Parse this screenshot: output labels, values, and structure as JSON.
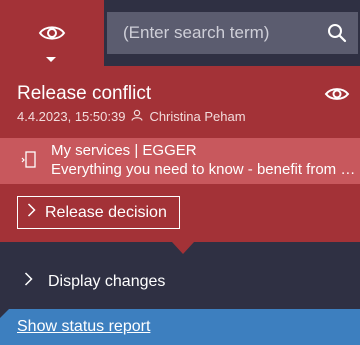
{
  "search": {
    "placeholder": "(Enter search term)"
  },
  "panel": {
    "title": "Release conflict",
    "date": "4.4.2023, 15:50:39",
    "user": "Christina Peham",
    "service_title": "My services | EGGER",
    "service_desc": "Everything you need to know - benefit from ex…",
    "release_label": "Release decision"
  },
  "changes_label": "Display changes",
  "footer": {
    "status_link": "Show status report"
  },
  "icons": {
    "eye": "eye-icon",
    "search": "search-icon",
    "person": "person-icon",
    "phone": "mobile-device-icon",
    "chevron": "chevron-right-icon"
  },
  "colors": {
    "dark": "#2f3043",
    "red": "#a33237",
    "red_light": "#c8585d",
    "search_bg": "#5b5c6f",
    "blue": "#3d7fbf"
  }
}
